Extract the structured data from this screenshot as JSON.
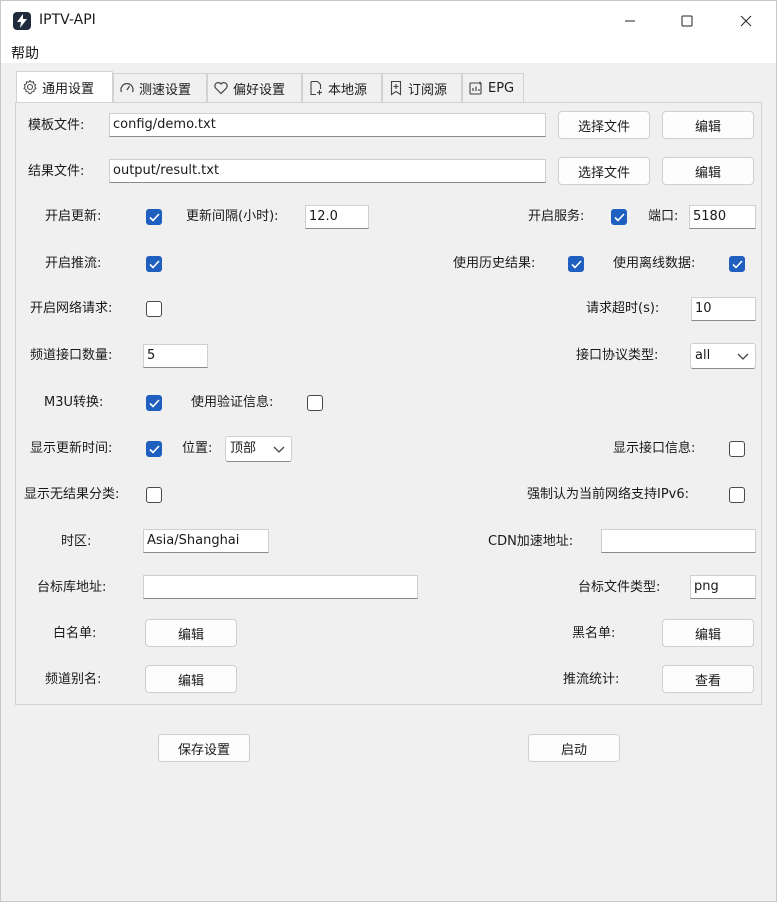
{
  "window": {
    "title": "IPTV-API",
    "icon": "lightning-icon"
  },
  "menu": {
    "help": "帮助"
  },
  "tabs": [
    {
      "label": "通用设置",
      "icon": "gear-icon"
    },
    {
      "label": "测速设置",
      "icon": "speedometer-icon"
    },
    {
      "label": "偏好设置",
      "icon": "heart-icon"
    },
    {
      "label": "本地源",
      "icon": "file-add-icon"
    },
    {
      "label": "订阅源",
      "icon": "bookmark-add-icon"
    },
    {
      "label": "EPG",
      "icon": "calendar-icon"
    }
  ],
  "general": {
    "template_file_label": "模板文件:",
    "template_file_value": "config/demo.txt",
    "result_file_label": "结果文件:",
    "result_file_value": "output/result.txt",
    "choose_file": "选择文件",
    "edit": "编辑",
    "open_update_label": "开启更新:",
    "open_update": true,
    "update_interval_label": "更新间隔(小时):",
    "update_interval_value": "12.0",
    "open_service_label": "开启服务:",
    "open_service": true,
    "port_label": "端口:",
    "port_value": "5180",
    "open_rtmp_label": "开启推流:",
    "open_rtmp": true,
    "use_history_label": "使用历史结果:",
    "use_history": true,
    "use_offline_label": "使用离线数据:",
    "use_offline": true,
    "open_request_label": "开启网络请求:",
    "open_request": false,
    "request_timeout_label": "请求超时(s):",
    "request_timeout_value": "10",
    "urls_limit_label": "频道接口数量:",
    "urls_limit_value": "5",
    "ipv_type_label": "接口协议类型:",
    "ipv_type_value": "all",
    "m3u_label": "M3U转换:",
    "m3u": true,
    "use_auth_label": "使用验证信息:",
    "use_auth": false,
    "show_update_time_label": "显示更新时间:",
    "show_update_time": true,
    "position_label": "位置:",
    "position_value": "顶部",
    "show_url_info_label": "显示接口信息:",
    "show_url_info": false,
    "show_no_result_label": "显示无结果分类:",
    "show_no_result": false,
    "force_ipv6_label": "强制认为当前网络支持IPv6:",
    "force_ipv6": false,
    "timezone_label": "时区:",
    "timezone_value": "Asia/Shanghai",
    "cdn_label": "CDN加速地址:",
    "cdn_value": "",
    "logo_url_label": "台标库地址:",
    "logo_url_value": "",
    "logo_type_label": "台标文件类型:",
    "logo_type_value": "png",
    "whitelist_label": "白名单:",
    "blacklist_label": "黑名单:",
    "alias_label": "频道别名:",
    "rtmp_stat_label": "推流统计:",
    "view": "查看"
  },
  "footer": {
    "save": "保存设置",
    "start": "启动"
  },
  "colors": {
    "accent": "#1e5fbf",
    "background": "#f0f0f0"
  }
}
